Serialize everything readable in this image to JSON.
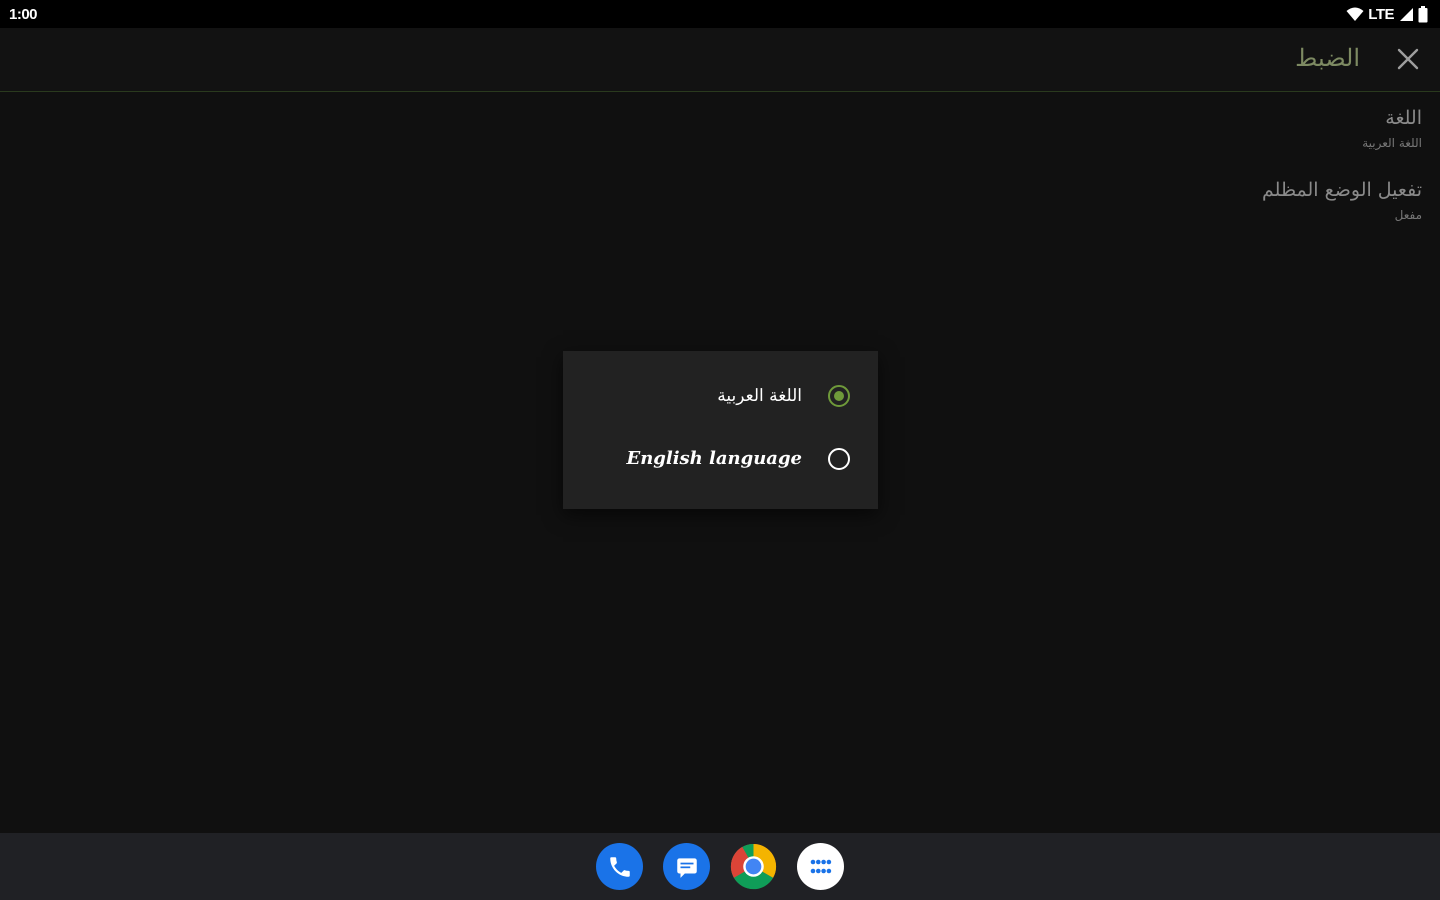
{
  "status_bar": {
    "time": "1:00",
    "network": "LTE",
    "icons": [
      "wifi-icon",
      "cell-signal-icon",
      "battery-icon"
    ]
  },
  "app_bar": {
    "title": "الضبط",
    "close_icon": "close-icon"
  },
  "settings": [
    {
      "title": "اللغة",
      "summary": "اللغة العربية"
    },
    {
      "title": "تفعيل الوضع المظلم",
      "summary": "مفعل"
    }
  ],
  "language_dialog": {
    "options": [
      {
        "label": "اللغة العربية",
        "selected": true
      },
      {
        "label": "English language",
        "selected": false
      }
    ],
    "accent_color": "#6f9a3a"
  },
  "dock": {
    "apps": [
      "phone-icon",
      "messages-icon",
      "chrome-icon",
      "app-drawer-icon"
    ]
  },
  "colors": {
    "background": "#101010",
    "title": "#7d8a62",
    "dialog": "#222222",
    "dock": "#202125"
  }
}
